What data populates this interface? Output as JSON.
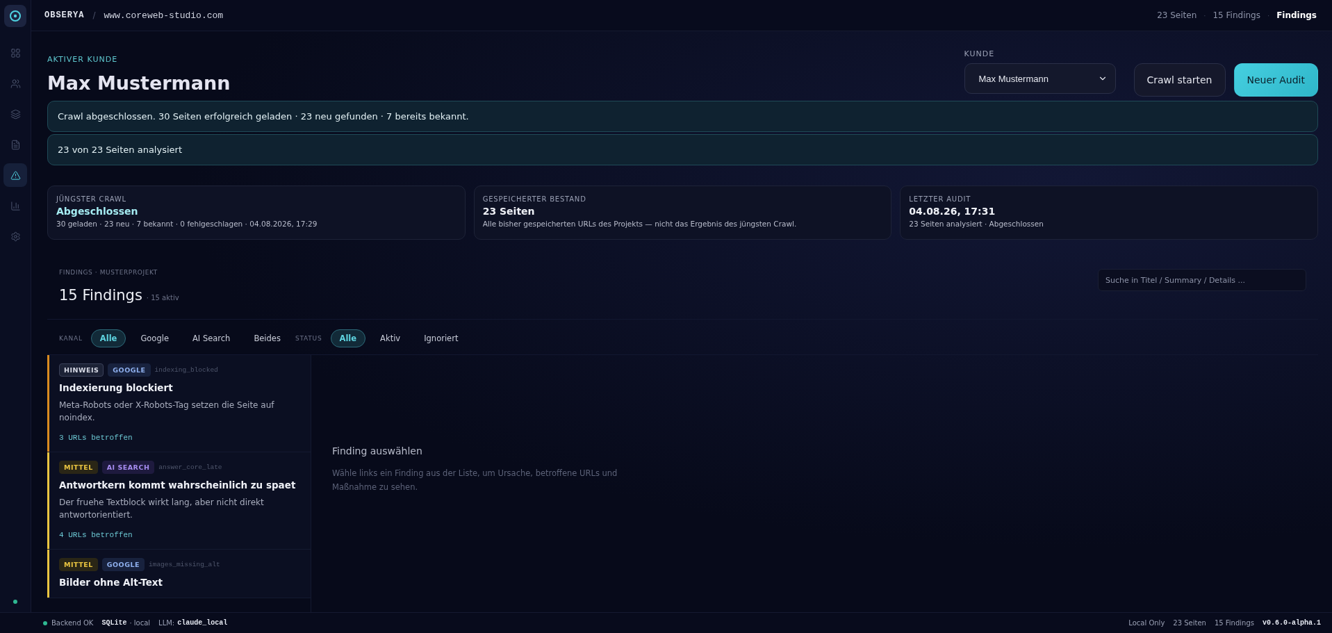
{
  "topbar": {
    "brand": "OBSERYA",
    "separator": "/",
    "crumb_separator": "·",
    "domain": "www.coreweb-studio.com",
    "crumbs": [
      "23 Seiten",
      "15 Findings",
      "Findings"
    ]
  },
  "sidebar": {
    "items": [
      {
        "kind": "grid",
        "selected": false
      },
      {
        "kind": "users",
        "selected": false
      },
      {
        "kind": "layers",
        "selected": false
      },
      {
        "kind": "file",
        "selected": false
      },
      {
        "kind": "alert",
        "selected": true
      },
      {
        "kind": "chart",
        "selected": false
      },
      {
        "kind": "settings",
        "selected": false
      }
    ]
  },
  "header": {
    "eyebrow": "AKTIVER KUNDE",
    "title": "Max Mustermann",
    "customer_label": "KUNDE",
    "customer_value": "Max Mustermann",
    "buttons": [
      {
        "label": "Crawl starten",
        "kind": "secondary"
      },
      {
        "label": "Neuer Audit",
        "kind": "primary"
      }
    ]
  },
  "banners": [
    "Crawl abgeschlossen. 30 Seiten erfolgreich geladen · 23 neu gefunden · 7 bereits bekannt.",
    "23 von 23 Seiten analysiert"
  ],
  "cards": [
    {
      "label": "JÜNGSTER CRAWL",
      "value": "Abgeschlossen",
      "accent": true,
      "detail": "30 geladen · 23 neu · 7 bekannt · 0 fehlgeschlagen · 04.08.2026, 17:29"
    },
    {
      "label": "GESPEICHERTER BESTAND",
      "value": "23 Seiten",
      "accent": false,
      "detail": "Alle bisher gespeicherten URLs des Projekts — nicht das Ergebnis des jüngsten Crawl."
    },
    {
      "label": "LETZTER AUDIT",
      "value": "04.08.26, 17:31",
      "accent": false,
      "detail": "23 Seiten analysiert · Abgeschlossen"
    }
  ],
  "findings": {
    "eyebrow": "FINDINGS · MUSTERPROJEKT",
    "title": "15 Findings",
    "count": "· 15 aktiv",
    "search": {
      "placeholder": "Suche in Titel / Summary / Details ..."
    },
    "filters": [
      {
        "label": "KANAL",
        "options": [
          {
            "label": "Alle",
            "selected": true
          },
          {
            "label": "Google",
            "selected": false
          },
          {
            "label": "AI Search",
            "selected": false
          },
          {
            "label": "Beides",
            "selected": false
          }
        ]
      },
      {
        "label": "STATUS",
        "options": [
          {
            "label": "Alle",
            "selected": true
          },
          {
            "label": "Aktiv",
            "selected": false
          },
          {
            "label": "Ignoriert",
            "selected": false
          }
        ]
      }
    ],
    "items": [
      {
        "color": "#d98b1f",
        "severity": {
          "label": "HINWEIS",
          "kind": "info"
        },
        "channel": {
          "label": "GOOGLE",
          "kind": "google"
        },
        "code": "indexing_blocked",
        "title": "Indexierung blockiert",
        "summary": "Meta-Robots oder X-Robots-Tag setzen die Seite auf noindex.",
        "urls": "3 URLs betroffen"
      },
      {
        "color": "#e9c441",
        "severity": {
          "label": "MITTEL",
          "kind": "medium"
        },
        "channel": {
          "label": "AI SEARCH",
          "kind": "ai"
        },
        "code": "answer_core_late",
        "title": "Antwortkern kommt wahrscheinlich zu spaet",
        "summary": "Der fruehe Textblock wirkt lang, aber nicht direkt antwortorientiert.",
        "urls": "4 URLs betroffen"
      },
      {
        "color": "#e9c441",
        "severity": {
          "label": "MITTEL",
          "kind": "medium"
        },
        "channel": {
          "label": "GOOGLE",
          "kind": "google"
        },
        "code": "images_missing_alt",
        "title": "Bilder ohne Alt-Text"
      }
    ],
    "detail": {
      "title": "Finding auswählen",
      "text": "Wähle links ein Finding aus der Liste, um Ursache, betroffene URLs und Maßnahme zu sehen."
    }
  },
  "statusbar": {
    "backend": "Backend OK",
    "db": "SQLite",
    "db_mode": "· local",
    "llm_label": "LLM:",
    "llm": "claude_local",
    "right": [
      "Local Only",
      "23 Seiten",
      "15 Findings"
    ],
    "version": "v0.6.0-alpha.1"
  }
}
